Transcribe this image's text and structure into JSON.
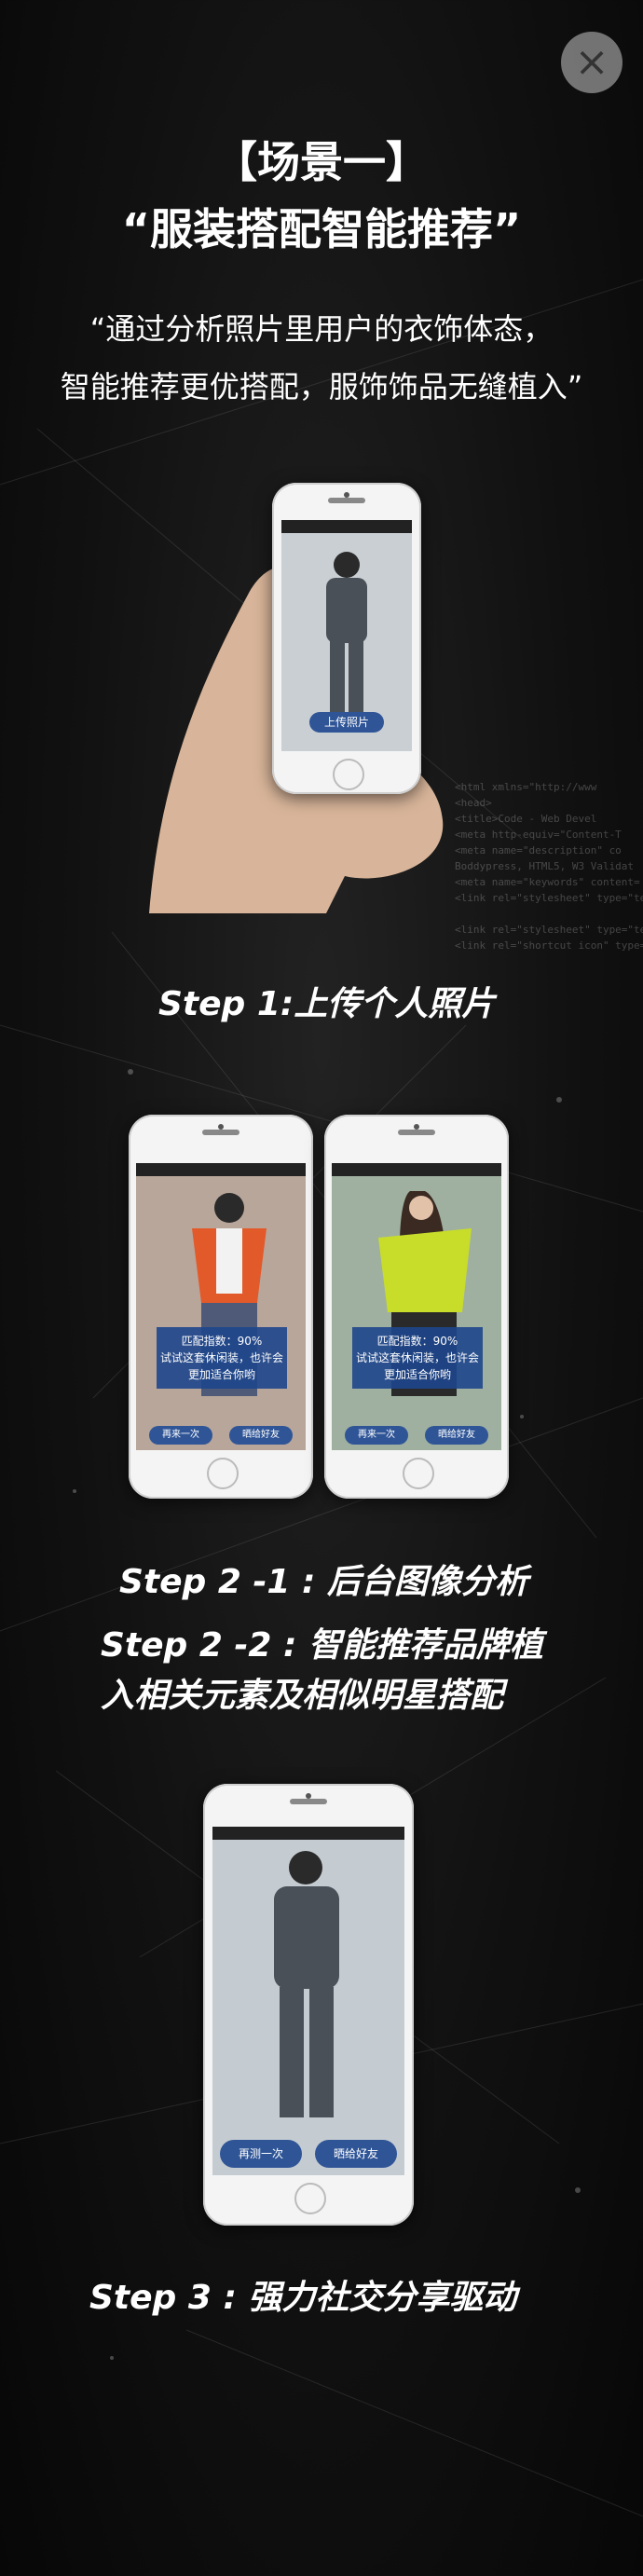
{
  "header": {
    "close_icon": "×",
    "title_line1": "【场景一】",
    "title_line2": "“服装搭配智能推荐”",
    "quote_line1": "“通过分析照片里用户的衣饰体态，",
    "quote_line2": "智能推荐更优搭配，服饰饰品无缝植入”"
  },
  "step1": {
    "label": "Step 1:上传个人照片",
    "upload_button": "上传照片"
  },
  "step2": {
    "label1": "Step 2 -1 : 后台图像分析",
    "label2a": "Step 2 -2 : 智能推荐品牌植",
    "label2b": "入相关元素及相似明星搭配",
    "left_phone": {
      "result_line1": "匹配指数：90%",
      "result_line2": "试试这套休闲装，也许会",
      "result_line3": "更加适合你哟",
      "btn_again": "再来一次",
      "btn_share": "晒给好友"
    },
    "right_phone": {
      "result_line1": "匹配指数：90%",
      "result_line2": "试试这套休闲装，也许会",
      "result_line3": "更加适合你哟",
      "btn_again": "再来一次",
      "btn_share": "晒给好友"
    }
  },
  "step3": {
    "label": "Step 3 : 强力社交分享驱动",
    "btn_again": "再测一次",
    "btn_share": "晒给好友"
  },
  "background_code": "<html xmlns=\"http://www\n<head>\n<title>Code - Web Devel\n<meta http-equiv=\"Content-T\n<meta name=\"description\" co\nBoddypress, HTML5, W3 Validat\n<meta name=\"keywords\" content=\n<link rel=\"stylesheet\" type=\"text/cs\n\n<link rel=\"stylesheet\" type=\"text/cs\n<link rel=\"shortcut icon\" type=\"image",
  "colors": {
    "button_blue": "#2f5597",
    "overlay_blue": "#1e468c"
  }
}
